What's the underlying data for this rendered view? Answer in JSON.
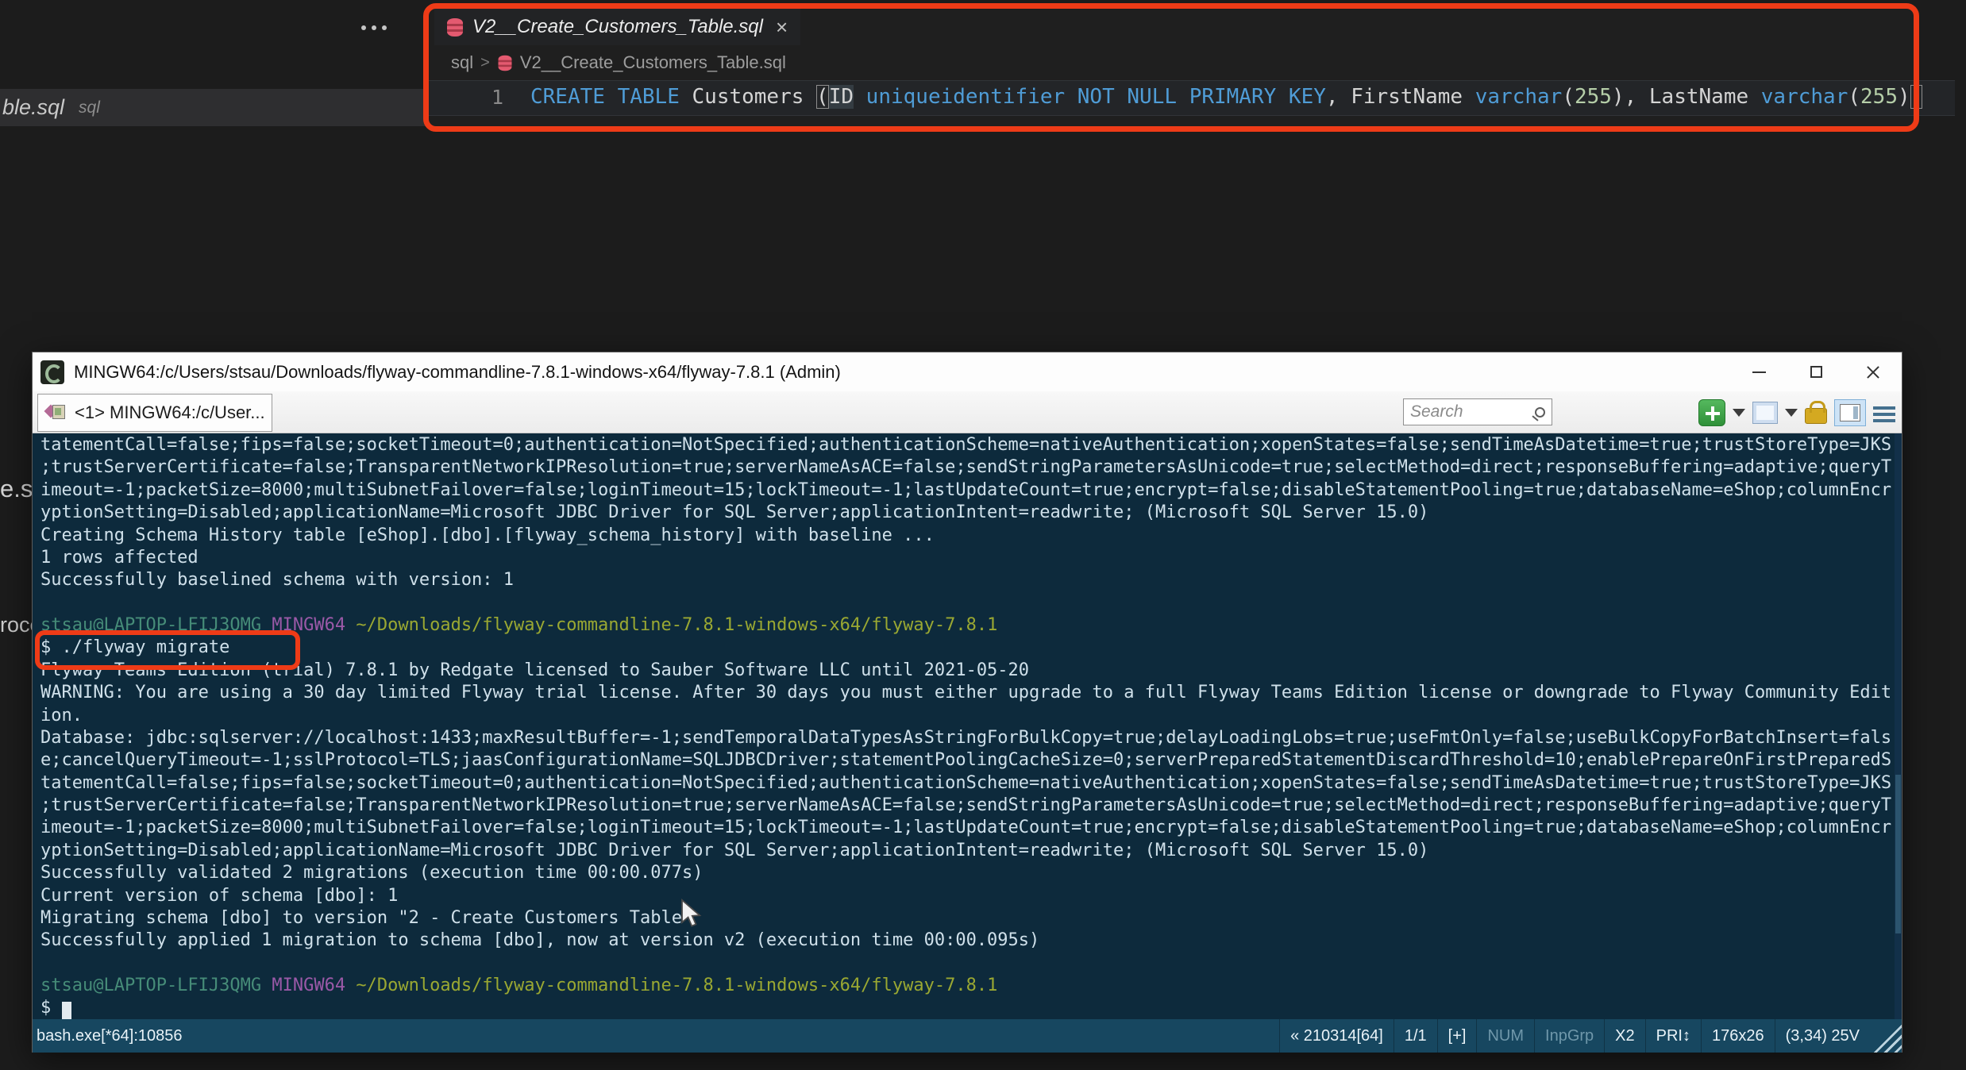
{
  "colors": {
    "annotation_red": "#ee3b17",
    "terminal_bg": "#0d2a3c",
    "terminal_text": "#cfe0ea",
    "prompt_user": "#468c78",
    "prompt_mingw": "#9b59a8",
    "prompt_path": "#9aa832",
    "status_bg": "#174760",
    "keyword_blue": "#4f9cd6"
  },
  "editor": {
    "tab": {
      "title": "V2__Create_Customers_Table.sql"
    },
    "breadcrumb": {
      "folder": "sql",
      "chevron": ">",
      "file": "V2__Create_Customers_Table.sql"
    },
    "line_number": "1",
    "code_segments": [
      [
        "kw",
        "CREATE"
      ],
      [
        "t",
        " "
      ],
      [
        "kw",
        "TABLE"
      ],
      [
        "t",
        " Customers "
      ],
      [
        "brk",
        "("
      ],
      [
        "hl",
        "ID"
      ],
      [
        "t",
        " "
      ],
      [
        "kw",
        "uniqueidentifier"
      ],
      [
        "t",
        " "
      ],
      [
        "kw",
        "NOT"
      ],
      [
        "t",
        " "
      ],
      [
        "kw",
        "NULL"
      ],
      [
        "t",
        " "
      ],
      [
        "kw",
        "PRIMARY"
      ],
      [
        "t",
        " "
      ],
      [
        "kw",
        "KEY"
      ],
      [
        "t",
        ", FirstName "
      ],
      [
        "kw",
        "varchar"
      ],
      [
        "t",
        "("
      ],
      [
        "num",
        "255"
      ],
      [
        "t",
        "), LastName "
      ],
      [
        "kw",
        "varchar"
      ],
      [
        "t",
        "("
      ],
      [
        "num",
        "255"
      ],
      [
        "t",
        ")"
      ],
      [
        "brk",
        ")"
      ]
    ],
    "background_tab_fragment": {
      "name": "ble.sql",
      "lang": "sql"
    },
    "fragments": [
      "e.sq",
      "roce"
    ]
  },
  "terminal": {
    "title": "MINGW64:/c/Users/stsau/Downloads/flyway-commandline-7.8.1-windows-x64/flyway-7.8.1 (Admin)",
    "tab_label": "<1> MINGW64:/c/User...",
    "search_placeholder": "Search",
    "lines": [
      [
        [
          "t",
          "tatementCall=false;fips=false;socketTimeout=0;authentication=NotSpecified;authenticationScheme=nativeAuthentication;xopenStates=false;sendTimeAsDatetime=true;trustStoreType=JKS"
        ]
      ],
      [
        [
          "t",
          ";trustServerCertificate=false;TransparentNetworkIPResolution=true;serverNameAsACE=false;sendStringParametersAsUnicode=true;selectMethod=direct;responseBuffering=adaptive;queryT"
        ]
      ],
      [
        [
          "t",
          "imeout=-1;packetSize=8000;multiSubnetFailover=false;loginTimeout=15;lockTimeout=-1;lastUpdateCount=true;encrypt=false;disableStatementPooling=true;databaseName=eShop;columnEncr"
        ]
      ],
      [
        [
          "t",
          "yptionSetting=Disabled;applicationName=Microsoft JDBC Driver for SQL Server;applicationIntent=readwrite; (Microsoft SQL Server 15.0)"
        ]
      ],
      [
        [
          "t",
          "Creating Schema History table [eShop].[dbo].[flyway_schema_history] with baseline ..."
        ]
      ],
      [
        [
          "t",
          "1 rows affected"
        ]
      ],
      [
        [
          "t",
          "Successfully baselined schema with version: 1"
        ]
      ],
      [],
      [
        [
          "u",
          "stsau@LAPTOP-LFIJ3QMG"
        ],
        [
          "t",
          " "
        ],
        [
          "m",
          "MINGW64"
        ],
        [
          "t",
          " "
        ],
        [
          "p",
          "~/Downloads/flyway-commandline-7.8.1-windows-x64/flyway-7.8.1"
        ]
      ],
      [
        [
          "t",
          "$ ./flyway migrate"
        ]
      ],
      [
        [
          "t",
          "Flyway Teams Edition (trial) 7.8.1 by Redgate licensed to Sauber Software LLC until 2021-05-20"
        ]
      ],
      [
        [
          "t",
          "WARNING: You are using a 30 day limited Flyway trial license. After 30 days you must either upgrade to a full Flyway Teams Edition license or downgrade to Flyway Community Edit"
        ]
      ],
      [
        [
          "t",
          "ion."
        ]
      ],
      [
        [
          "t",
          "Database: jdbc:sqlserver://localhost:1433;maxResultBuffer=-1;sendTemporalDataTypesAsStringForBulkCopy=true;delayLoadingLobs=true;useFmtOnly=false;useBulkCopyForBatchInsert=fals"
        ]
      ],
      [
        [
          "t",
          "e;cancelQueryTimeout=-1;sslProtocol=TLS;jaasConfigurationName=SQLJDBCDriver;statementPoolingCacheSize=0;serverPreparedStatementDiscardThreshold=10;enablePrepareOnFirstPreparedS"
        ]
      ],
      [
        [
          "t",
          "tatementCall=false;fips=false;socketTimeout=0;authentication=NotSpecified;authenticationScheme=nativeAuthentication;xopenStates=false;sendTimeAsDatetime=true;trustStoreType=JKS"
        ]
      ],
      [
        [
          "t",
          ";trustServerCertificate=false;TransparentNetworkIPResolution=true;serverNameAsACE=false;sendStringParametersAsUnicode=true;selectMethod=direct;responseBuffering=adaptive;queryT"
        ]
      ],
      [
        [
          "t",
          "imeout=-1;packetSize=8000;multiSubnetFailover=false;loginTimeout=15;lockTimeout=-1;lastUpdateCount=true;encrypt=false;disableStatementPooling=true;databaseName=eShop;columnEncr"
        ]
      ],
      [
        [
          "t",
          "yptionSetting=Disabled;applicationName=Microsoft JDBC Driver for SQL Server;applicationIntent=readwrite; (Microsoft SQL Server 15.0)"
        ]
      ],
      [
        [
          "t",
          "Successfully validated 2 migrations (execution time 00:00.077s)"
        ]
      ],
      [
        [
          "t",
          "Current version of schema [dbo]: 1"
        ]
      ],
      [
        [
          "t",
          "Migrating schema [dbo] to version \"2 - Create Customers Table\""
        ]
      ],
      [
        [
          "t",
          "Successfully applied 1 migration to schema [dbo], now at version v2 (execution time 00:00.095s)"
        ]
      ],
      [],
      [
        [
          "u",
          "stsau@LAPTOP-LFIJ3QMG"
        ],
        [
          "t",
          " "
        ],
        [
          "m",
          "MINGW64"
        ],
        [
          "t",
          " "
        ],
        [
          "p",
          "~/Downloads/flyway-commandline-7.8.1-windows-x64/flyway-7.8.1"
        ]
      ],
      [
        [
          "t",
          "$ "
        ],
        [
          "cur",
          " "
        ]
      ]
    ],
    "status": {
      "left": "bash.exe[*64]:10856",
      "cells": [
        {
          "label": "« 210314[64]"
        },
        {
          "label": "1/1"
        },
        {
          "label": "[+]"
        },
        {
          "label": "NUM",
          "dim": true
        },
        {
          "label": "InpGrp",
          "dim": true
        },
        {
          "label": "X2"
        },
        {
          "label": "PRI↕"
        },
        {
          "label": "176x26"
        },
        {
          "label": "(3,34) 25V"
        }
      ]
    }
  }
}
